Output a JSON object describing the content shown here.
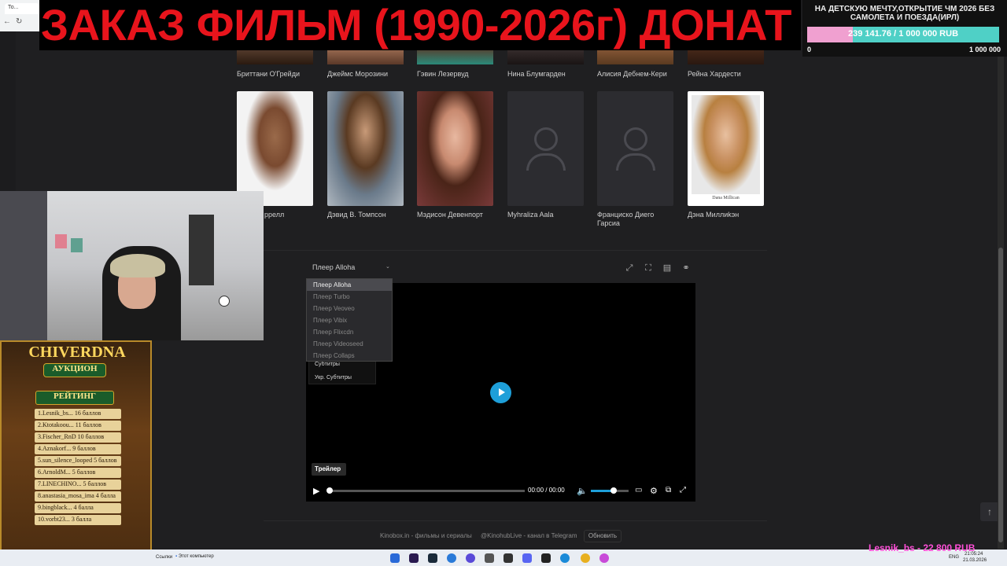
{
  "browser": {
    "tab_label": "То..."
  },
  "cast": {
    "row1": [
      "Бриттани О'Грейди",
      "Джеймс Морозини",
      "Гэвин Лезервуд",
      "Нина Блумгарден",
      "Алисия Дебнем-Кери",
      "Рейна Хардести"
    ],
    "row2": [
      {
        "name": "Тони Террелл",
        "visible_name": "ррелл",
        "photo": true
      },
      {
        "name": "Дэвид В. Томпсон",
        "photo": true
      },
      {
        "name": "Мэдисон Девенпорт",
        "photo": true
      },
      {
        "name": "Myhraliza Aala",
        "photo": false
      },
      {
        "name": "Франциско Диего Гарсиа",
        "photo": false
      },
      {
        "name": "Дэна Миллиkэн",
        "photo": true,
        "caption": "Dana Millican"
      }
    ]
  },
  "player": {
    "selected": "Плеер Alloha",
    "options": [
      "Плеер Alloha",
      "Плеер Turbo",
      "Плеер Veoveo",
      "Плеер Vibix",
      "Плеер Flixcdn",
      "Плеер Videoseed",
      "Плеер Collaps"
    ],
    "subtitles": [
      "Субтитры",
      "Укр. Субтитры"
    ],
    "trailer_label": "Трейлер",
    "time_current": "00:00",
    "time_sep": "/",
    "time_total": "00:00",
    "progress": 0,
    "volume": 0.6
  },
  "footer": {
    "link1": "Kinobox.in - фильмы и сериалы",
    "link2": "@KinohubLive - канал в Telegram",
    "refresh": "Обновить"
  },
  "overlay": {
    "banner": "ЗАКАЗ ФИЛЬМ (1990-2026г) ДОНАТ",
    "goal_title": "НА ДЕТСКУЮ МЕЧТУ,ОТКРЫТИЕ ЧМ 2026 БЕЗ САМОЛЕТА И ПОЕЗДА(ИРЛ)",
    "goal_amount": "239 141.76 / 1 000 000 RUB",
    "goal_min": "0",
    "goal_max": "1 000 000",
    "goal_progress": 0.239,
    "auction_title": "CHIVERDNA",
    "auction_sub": "АУКЦИОН",
    "rating_title": "РЕЙТИНГ",
    "rating": [
      "1.Lesnik_bs... 16 баллов",
      "2.Ktotakoou... 11 баллов",
      "3.Fischer_RnD 10 баллов",
      "4.Aznakorf... 9 баллов",
      "5.sun_silence_looped 5 баллов",
      "6.ArnoldM... 5 баллов",
      "7.LINECHINO... 5 баллов",
      "8.anastasia_mosa_ima 4 балла",
      "9.bingblack... 4 балла",
      "10.vorbt23... 3 балла"
    ],
    "donation": "Lesnik_bs - 22 800 RUB"
  },
  "taskbar": {
    "links_label": "Ссылки",
    "this_pc": "Этот компьютер",
    "lang": "ENG",
    "time": "21:05:24",
    "date": "21.03.2026"
  }
}
